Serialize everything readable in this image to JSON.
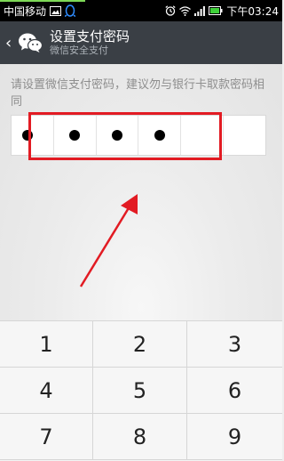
{
  "status_bar": {
    "carrier": "中国移动",
    "time": "下午03:24"
  },
  "title_bar": {
    "title": "设置支付密码",
    "subtitle": "微信安全支付"
  },
  "instruction": "请设置微信支付密码，建议勿与银行卡取款密码相同",
  "pin": {
    "cells": [
      "●",
      "●",
      "●",
      "●",
      "",
      ""
    ],
    "entered": 4,
    "length": 6
  },
  "annotation": {
    "highlight_color": "#e21b23",
    "arrow_color": "#e21b23"
  },
  "keypad": {
    "keys": [
      "1",
      "2",
      "3",
      "4",
      "5",
      "6",
      "7",
      "8",
      "9"
    ]
  },
  "colors": {
    "title_bar_bg": "#3a3f45",
    "status_bar_bg": "#000000",
    "battery_green": "#3fd13a"
  }
}
